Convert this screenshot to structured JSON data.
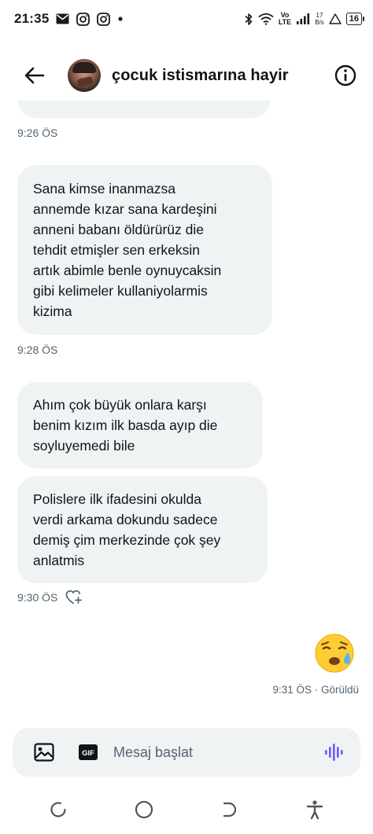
{
  "status_bar": {
    "time": "21:35",
    "lte_label": "Vo\nLTE",
    "speed_value": "17",
    "speed_unit": "B/s",
    "battery": "16"
  },
  "header": {
    "title": "çocuk istismarına hayir"
  },
  "messages": [
    {
      "text": "Sana kimse inanmazsa\nannemde kızar sana kardeşini\nanneni babanı öldürürüz die\ntehdit etmişler sen erkeksin\nartık abimle benle oynuycaksin\ngibi kelimeler kullaniyolarmis\nkizima"
    },
    {
      "text": "Ahım çok büyük onlara karşı\nbenim kızım ilk basda ayıp die\nsoyluyemedi bile"
    },
    {
      "text": "Polislere ilk ifadesini okulda\nverdi arkama dokundu sadece\ndemiş çim merkezinde çok şey\nanlatmis"
    }
  ],
  "timestamps": {
    "t1": "9:26 ÖS",
    "t2": "9:28 ÖS",
    "t3": "9:30 ÖS"
  },
  "sent": {
    "emoji": "sad-tear-face",
    "status": "9:31 ÖS · Görüldü"
  },
  "composer": {
    "placeholder": "Mesaj başlat",
    "gif_label": "GIF"
  },
  "colors": {
    "bubble_bg": "#eff3f4",
    "muted_text": "#536471",
    "accent_voice": "#7856ff"
  }
}
